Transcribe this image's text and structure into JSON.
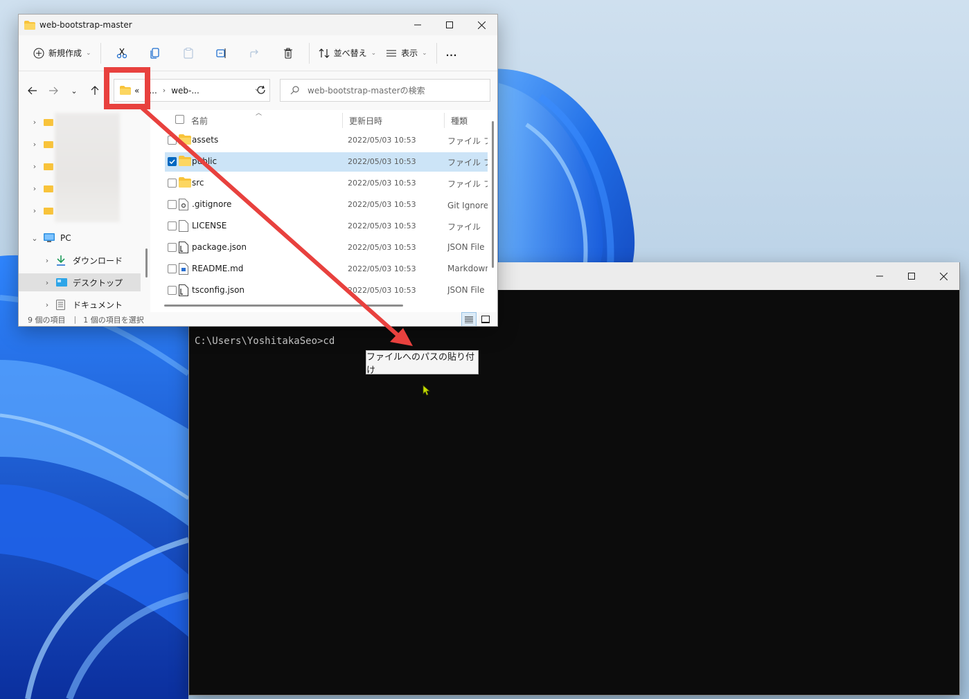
{
  "explorer": {
    "title": "web-bootstrap-master",
    "toolbar": {
      "new_label": "新規作成",
      "sort_label": "並べ替え",
      "view_label": "表示",
      "more_label": "..."
    },
    "address": {
      "overflow": "«",
      "crumb1": "...",
      "crumb2": "web-..."
    },
    "search_placeholder": "web-bootstrap-masterの検索",
    "columns": {
      "name": "名前",
      "date": "更新日時",
      "type": "種類"
    },
    "files": [
      {
        "name": "assets",
        "date": "2022/05/03 10:53",
        "type": "ファイル フォルダー",
        "icon": "folder-icon"
      },
      {
        "name": "public",
        "date": "2022/05/03 10:53",
        "type": "ファイル フォルダー",
        "icon": "folder-icon",
        "selected": true
      },
      {
        "name": "src",
        "date": "2022/05/03 10:53",
        "type": "ファイル フォルダー",
        "icon": "folder-icon"
      },
      {
        "name": ".gitignore",
        "date": "2022/05/03 10:53",
        "type": "Git Ignore ソース",
        "icon": "gear-file-icon"
      },
      {
        "name": "LICENSE",
        "date": "2022/05/03 10:53",
        "type": "ファイル",
        "icon": "blank-file-icon"
      },
      {
        "name": "package.json",
        "date": "2022/05/03 10:53",
        "type": "JSON File",
        "icon": "json-file-icon"
      },
      {
        "name": "README.md",
        "date": "2022/05/03 10:53",
        "type": "Markdown",
        "icon": "markdown-file-icon"
      },
      {
        "name": "tsconfig.json",
        "date": "2022/05/03 10:53",
        "type": "JSON File",
        "icon": "json-file-icon"
      }
    ],
    "sidebar": {
      "pc": "PC",
      "downloads": "ダウンロード",
      "desktop": "デスクトップ",
      "documents": "ドキュメント"
    },
    "status": {
      "count": "9 個の項目",
      "selected": "1 個の項目を選択"
    }
  },
  "terminal": {
    "prompt": "C:\\Users\\YoshitakaSeo>cd",
    "tooltip": "ファイルへのパスの貼り付け"
  },
  "colors": {
    "accent": "#0067c0",
    "annotation": "#e8413e",
    "folder": "#f8c33a",
    "selection": "#cce4f7"
  }
}
